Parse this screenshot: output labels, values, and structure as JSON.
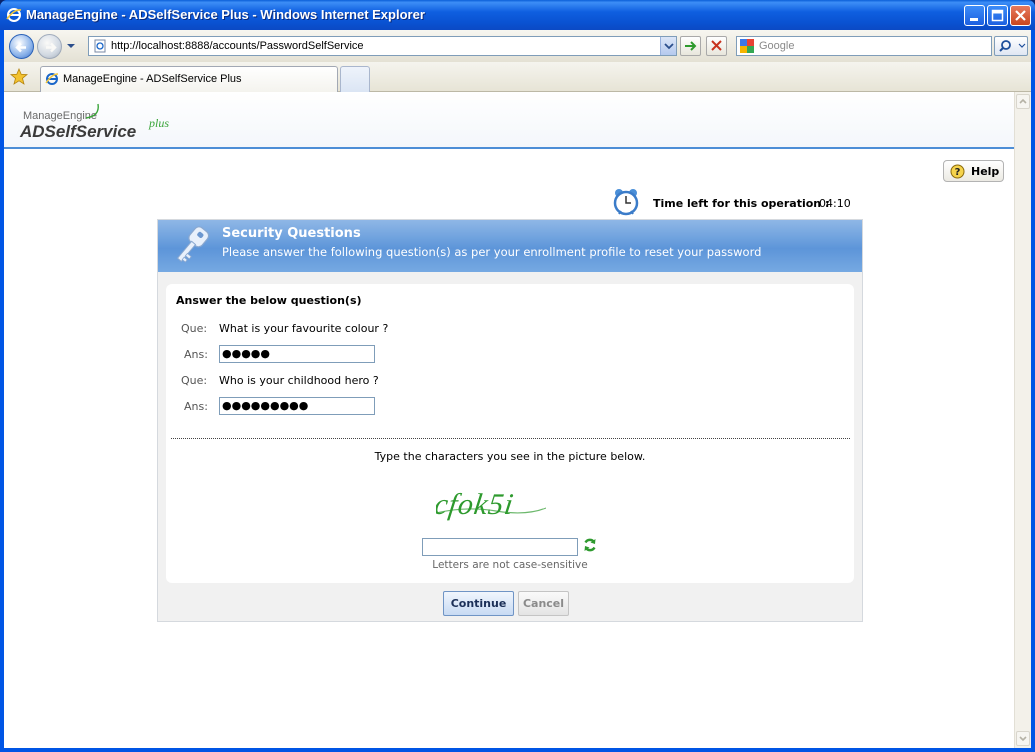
{
  "window": {
    "title": "ManageEngine - ADSelfService Plus - Windows Internet Explorer"
  },
  "browser": {
    "address": "http://localhost:8888/accounts/PasswordSelfService",
    "search_placeholder": "Google",
    "tab_label": "ManageEngine - ADSelfService Plus"
  },
  "app": {
    "brand_small": "ManageEngine",
    "brand_name": "ADSelfService",
    "brand_plus": "plus",
    "help_label": "Help",
    "time_label": "Time left for this operation :",
    "time_value": "04:10"
  },
  "panel": {
    "title": "Security Questions",
    "subtitle": "Please answer the following question(s) as per your enrollment profile to reset your password",
    "heading": "Answer the below question(s)",
    "que_label": "Que:",
    "ans_label": "Ans:",
    "questions": [
      {
        "question": "What is your favourite colour ?",
        "answer_masked": "●●●●●"
      },
      {
        "question": "Who is your childhood hero ?",
        "answer_masked": "●●●●●●●●●"
      }
    ],
    "captcha_instruction": "Type the characters you see in the picture below.",
    "captcha_text": "cfok5i",
    "captcha_note": "Letters are not case-sensitive"
  },
  "actions": {
    "continue_label": "Continue",
    "cancel_label": "Cancel"
  },
  "colors": {
    "header_blue": "#5d95d9",
    "captcha_green": "#2e9a2e",
    "xp_title_blue": "#0a52d2"
  }
}
